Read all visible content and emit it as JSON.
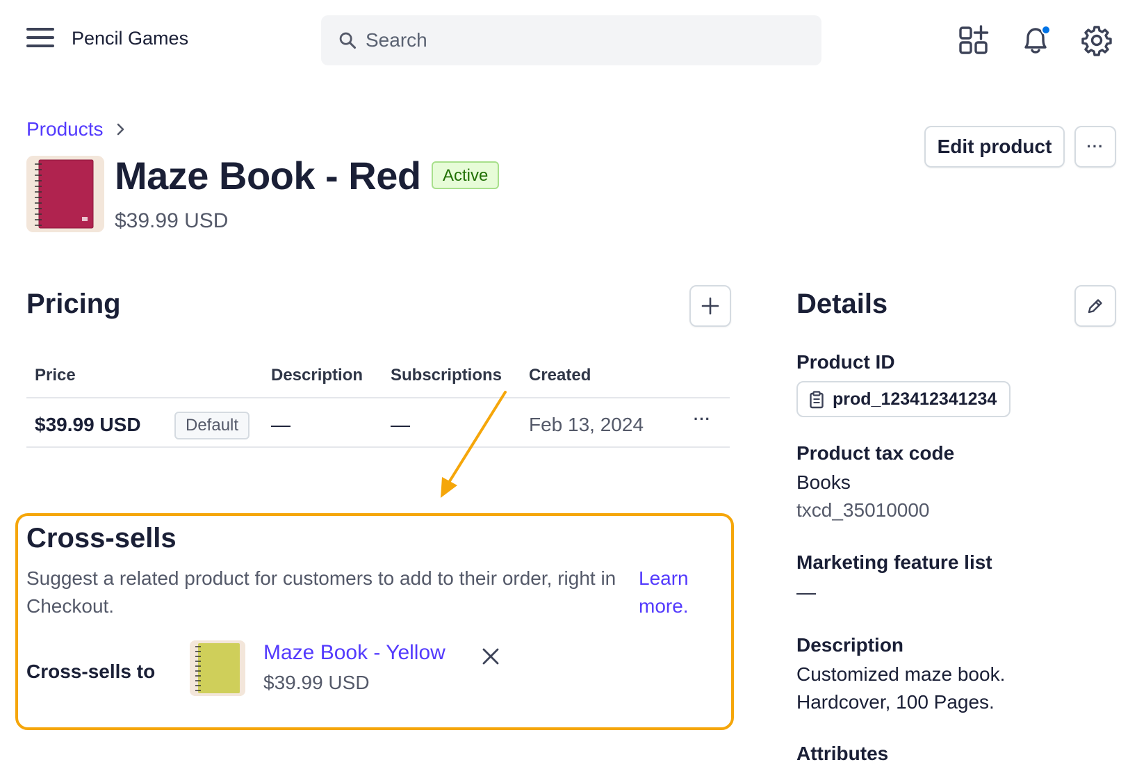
{
  "topbar": {
    "app_name": "Pencil Games",
    "search_placeholder": "Search"
  },
  "header": {
    "breadcrumb": "Products",
    "title": "Maze Book - Red",
    "status": "Active",
    "price": "$39.99 USD",
    "edit_label": "Edit product",
    "more_label": "···"
  },
  "pricing": {
    "title": "Pricing",
    "columns": [
      "Price",
      "Description",
      "Subscriptions",
      "Created"
    ],
    "rows": [
      {
        "price": "$39.99 USD",
        "badge": "Default",
        "description": "—",
        "subscriptions": "—",
        "created": "Feb 13, 2024",
        "more": "···"
      }
    ]
  },
  "cross_sells": {
    "title": "Cross-sells",
    "description": "Suggest a related product for customers to add to their order, right in Checkout.",
    "learn_more": "Learn more.",
    "label": "Cross-sells to",
    "product_name": "Maze Book - Yellow",
    "product_price": "$39.99 USD"
  },
  "details": {
    "title": "Details",
    "product_id_label": "Product ID",
    "product_id": "prod_123412341234",
    "tax_code_label": "Product tax code",
    "tax_code_name": "Books",
    "tax_code_id": "txcd_35010000",
    "marketing_label": "Marketing feature list",
    "marketing_value": "—",
    "description_label": "Description",
    "description_line1": "Customized maze book.",
    "description_line2": "Hardcover, 100 Pages.",
    "attributes_label": "Attributes"
  },
  "colors": {
    "accent": "#533afd",
    "highlight": "#f5a60a",
    "active_badge_bg": "#e7fcd8",
    "active_badge_text": "#217005",
    "red_book": "#b0234f",
    "yellow_book": "#cfcf5a"
  },
  "icons": [
    "menu-icon",
    "search-icon",
    "add-apps-icon",
    "bell-icon",
    "gear-icon",
    "chevron-right-icon",
    "plus-icon",
    "pencil-icon",
    "clipboard-icon",
    "close-icon"
  ]
}
